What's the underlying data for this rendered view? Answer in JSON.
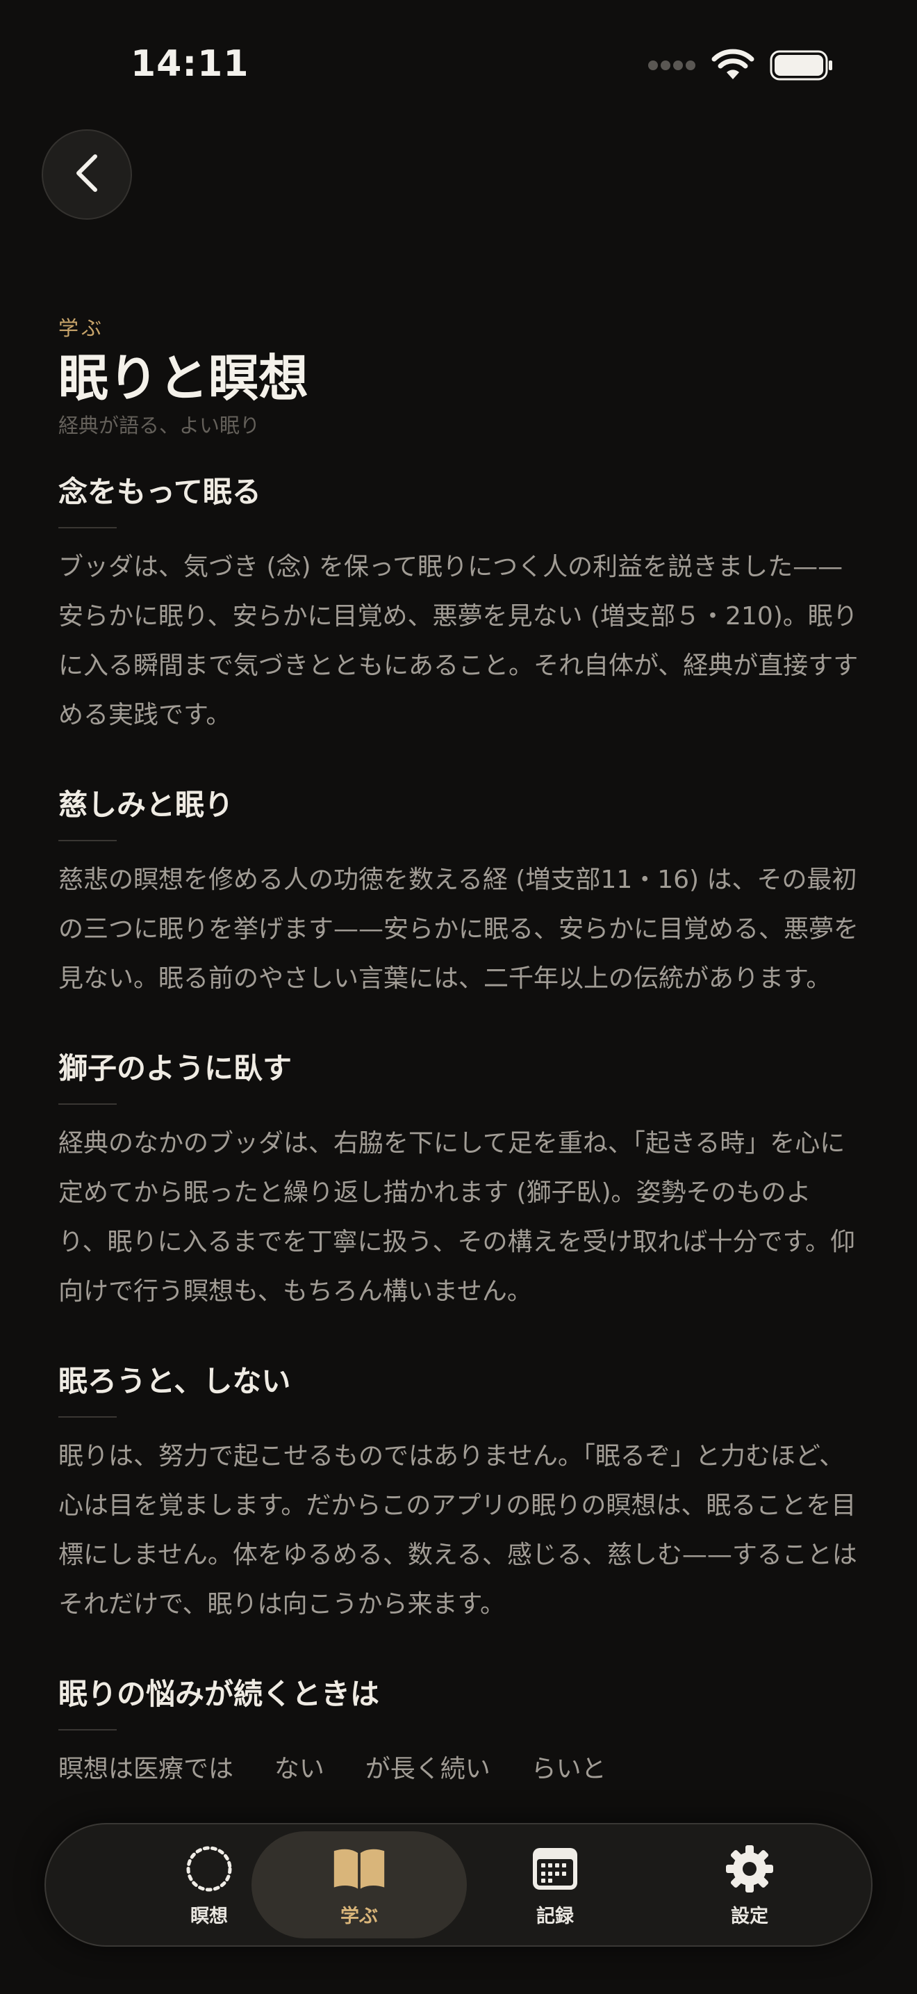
{
  "status": {
    "time": "14:11"
  },
  "header": {
    "eyebrow": "学ぶ",
    "title": "眠りと瞑想",
    "subtitle": "経典が語る、よい眠り"
  },
  "sections": [
    {
      "title": "念をもって眠る",
      "body": "ブッダは、気づき (念) を保って眠りにつく人の利益を説きました——安らかに眠り、安らかに目覚め、悪夢を見ない (増支部５・210)。眠りに入る瞬間まで気づきとともにあること。それ自体が、経典が直接すすめる実践です。"
    },
    {
      "title": "慈しみと眠り",
      "body": "慈悲の瞑想を修める人の功徳を数える経 (増支部11・16) は、その最初の三つに眠りを挙げます——安らかに眠る、安らかに目覚める、悪夢を見ない。眠る前のやさしい言葉には、二千年以上の伝統があります。"
    },
    {
      "title": "獅子のように臥す",
      "body": "経典のなかのブッダは、右脇を下にして足を重ね、「起きる時」を心に定めてから眠ったと繰り返し描かれます (獅子臥)。姿勢そのものより、眠りに入るまでを丁寧に扱う、その構えを受け取れば十分です。仰向けで行う瞑想も、もちろん構いません。"
    },
    {
      "title": "眠ろうと、しない",
      "body": "眠りは、努力で起こせるものではありません。「眠るぞ」と力むほど、心は目を覚まします。だからこのアプリの眠りの瞑想は、眠ることを目標にしません。体をゆるめる、数える、感じる、慈しむ——することはそれだけで、眠りは向こうから来ます。"
    },
    {
      "title": "眠りの悩みが続くときは",
      "body": "瞑想は医療では 　 ない 　 が長く続い 　 らいと"
    }
  ],
  "tabs": [
    {
      "label": "瞑想",
      "icon": "meditation-ring-icon",
      "active": false
    },
    {
      "label": "学ぶ",
      "icon": "book-icon",
      "active": true
    },
    {
      "label": "記録",
      "icon": "calendar-icon",
      "active": false
    },
    {
      "label": "設定",
      "icon": "gear-icon",
      "active": false
    }
  ],
  "colors": {
    "background": "#0f0e0d",
    "accent": "#d9b57a",
    "eyebrow": "#c9a56b",
    "title": "#f4f1ea",
    "body": "#a19c95"
  }
}
